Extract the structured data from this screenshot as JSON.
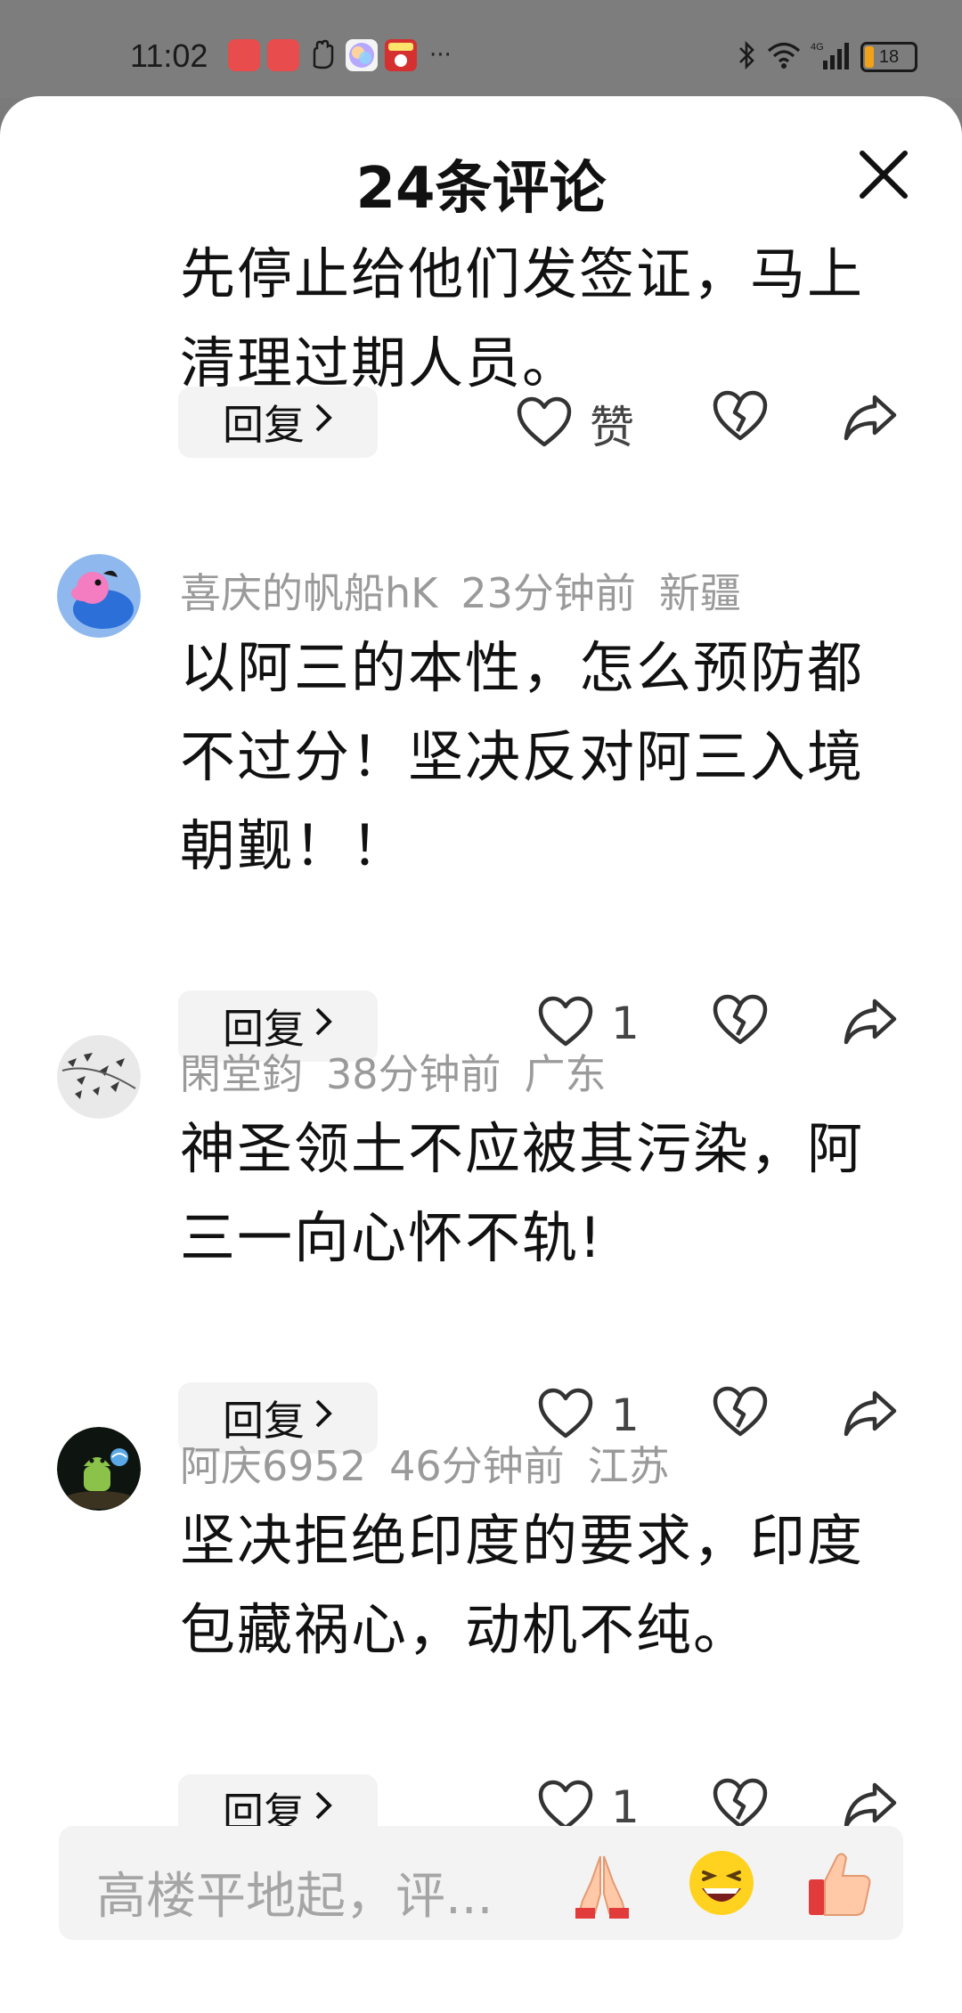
{
  "status_bar": {
    "time": "11:02",
    "more": "···",
    "battery": "18"
  },
  "sheet": {
    "title": "24条评论"
  },
  "comments": [
    {
      "text": "先停止给他们发签证，马上清理过期人员。",
      "reply_label": "回复",
      "like_label": "赞"
    },
    {
      "user": "喜庆的帆船hK",
      "time": "23分钟前",
      "location": "新疆",
      "text": "以阿三的本性，怎么预防都不过分！坚决反对阿三入境朝觐！！",
      "reply_label": "回复",
      "likes": "1"
    },
    {
      "user": "閑堂鈞",
      "time": "38分钟前",
      "location": "广东",
      "text": "神圣领土不应被其污染，阿三一向心怀不轨!",
      "reply_label": "回复",
      "likes": "1"
    },
    {
      "user": "阿庆6952",
      "time": "46分钟前",
      "location": "江苏",
      "text": "坚决拒绝印度的要求，印度包藏祸心，动机不纯。",
      "reply_label": "回复",
      "likes": "1"
    }
  ],
  "input": {
    "placeholder": "高楼平地起，评..."
  }
}
